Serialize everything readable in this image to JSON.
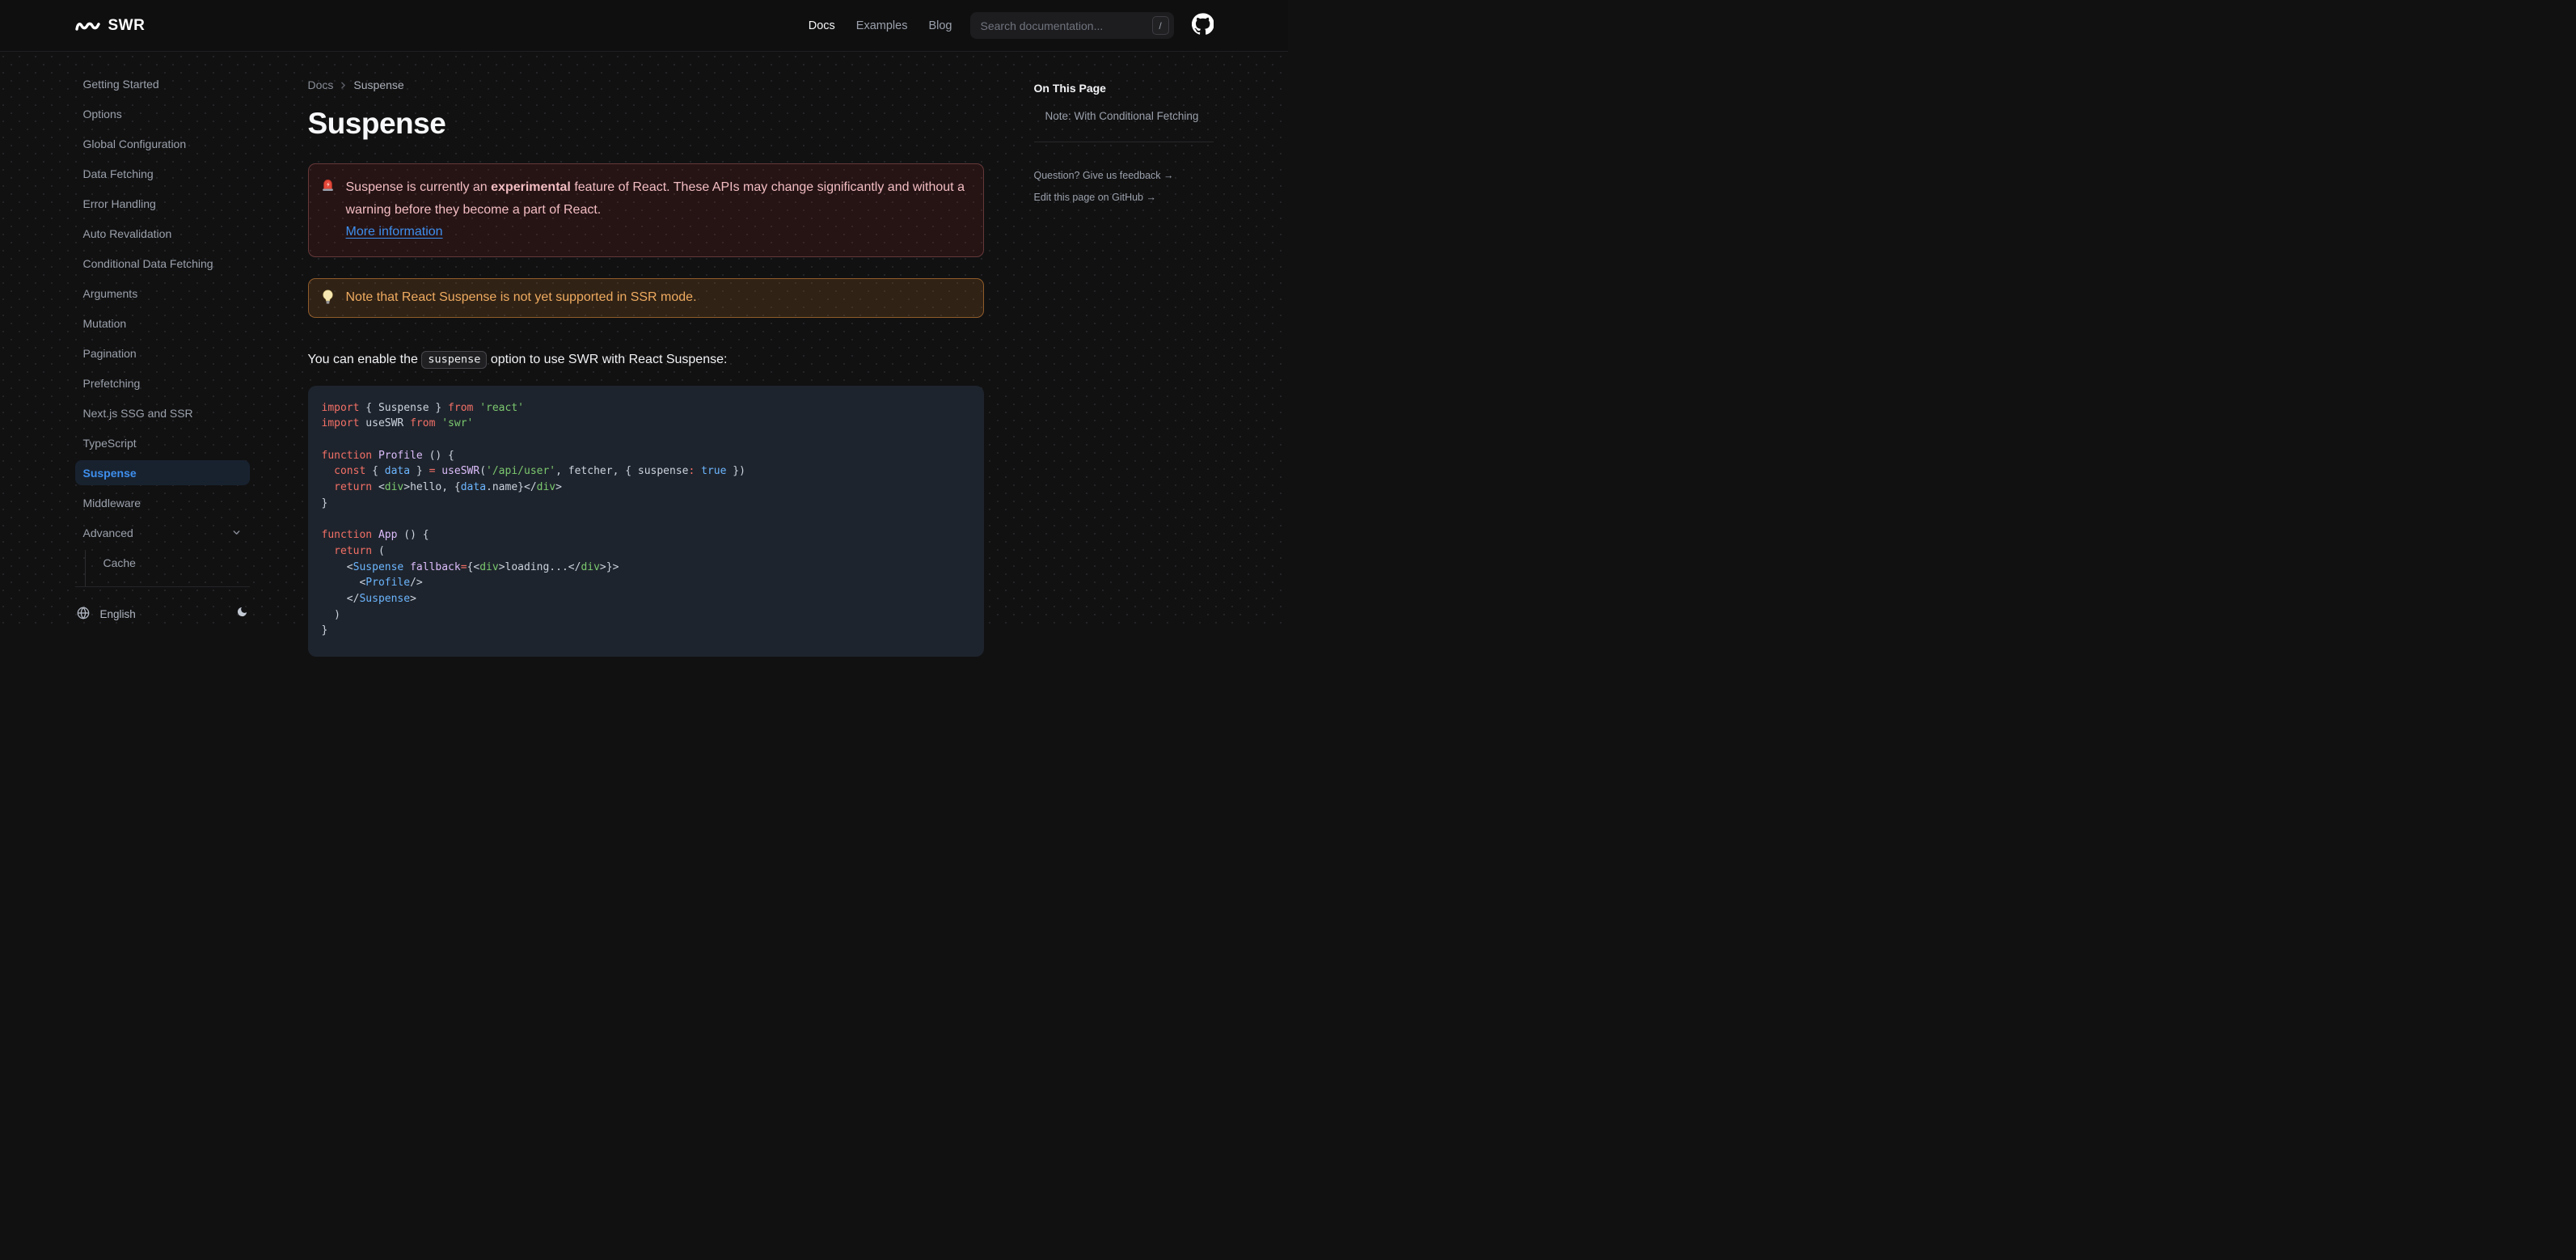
{
  "header": {
    "logo_text": "SWR",
    "nav": [
      {
        "label": "Docs",
        "active": true
      },
      {
        "label": "Examples",
        "active": false
      },
      {
        "label": "Blog",
        "active": false
      }
    ],
    "search": {
      "placeholder": "Search documentation...",
      "kbd": "/"
    },
    "github_icon": "github-icon"
  },
  "sidebar": {
    "items": [
      {
        "label": "Getting Started"
      },
      {
        "label": "Options"
      },
      {
        "label": "Global Configuration"
      },
      {
        "label": "Data Fetching"
      },
      {
        "label": "Error Handling"
      },
      {
        "label": "Auto Revalidation"
      },
      {
        "label": "Conditional Data Fetching"
      },
      {
        "label": "Arguments"
      },
      {
        "label": "Mutation"
      },
      {
        "label": "Pagination"
      },
      {
        "label": "Prefetching"
      },
      {
        "label": "Next.js SSG and SSR"
      },
      {
        "label": "TypeScript"
      },
      {
        "label": "Suspense",
        "active": true
      },
      {
        "label": "Middleware"
      },
      {
        "label": "Advanced",
        "chevron": true
      },
      {
        "label": "Cache",
        "sub": true
      }
    ],
    "footer": {
      "language": "English",
      "globe_icon": "globe-icon",
      "moon_icon": "moon-icon"
    }
  },
  "breadcrumb": {
    "parent": "Docs",
    "current": "Suspense"
  },
  "page": {
    "title": "Suspense",
    "callout_error": {
      "icon": "police-car-light-icon",
      "text_before": "Suspense is currently an ",
      "text_bold": "experimental",
      "text_after": " feature of React. These APIs may change significantly and without a warning before they become a part of React.",
      "link_label": "More information"
    },
    "callout_note": {
      "icon": "light-bulb-icon",
      "text": "Note that React Suspense is not yet supported in SSR mode."
    },
    "paragraph": {
      "before": "You can enable the ",
      "code": "suspense",
      "after": " option to use SWR with React Suspense:"
    }
  },
  "code_block": {
    "language": "jsx",
    "colors": {
      "keyword": "#f47067",
      "string_and_tag": "#7bc86f",
      "function": "#dcbdfb",
      "constant": "#6cb6ff",
      "plain": "#cdd3dc",
      "background": "#1e242d"
    },
    "lines": [
      [
        [
          "k",
          "import"
        ],
        [
          "p",
          " { Suspense } "
        ],
        [
          "k",
          "from"
        ],
        [
          "p",
          " "
        ],
        [
          "s",
          "'react'"
        ]
      ],
      [
        [
          "k",
          "import"
        ],
        [
          "p",
          " useSWR "
        ],
        [
          "k",
          "from"
        ],
        [
          "p",
          " "
        ],
        [
          "s",
          "'swr'"
        ]
      ],
      [],
      [
        [
          "k",
          "function"
        ],
        [
          "p",
          " "
        ],
        [
          "f",
          "Profile"
        ],
        [
          "p",
          " () {"
        ]
      ],
      [
        [
          "p",
          "  "
        ],
        [
          "k",
          "const"
        ],
        [
          "p",
          " { "
        ],
        [
          "c",
          "data"
        ],
        [
          "p",
          " } "
        ],
        [
          "k",
          "="
        ],
        [
          "p",
          " "
        ],
        [
          "f",
          "useSWR"
        ],
        [
          "p",
          "("
        ],
        [
          "s",
          "'/api/user'"
        ],
        [
          "p",
          ", fetcher, { suspense"
        ],
        [
          "k",
          ":"
        ],
        [
          "p",
          " "
        ],
        [
          "c",
          "true"
        ],
        [
          "p",
          " })"
        ]
      ],
      [
        [
          "p",
          "  "
        ],
        [
          "k",
          "return"
        ],
        [
          "p",
          " <"
        ],
        [
          "s",
          "div"
        ],
        [
          "p",
          ">hello, {"
        ],
        [
          "c",
          "data"
        ],
        [
          "p",
          ".name}</"
        ],
        [
          "s",
          "div"
        ],
        [
          "p",
          ">"
        ]
      ],
      [
        [
          "p",
          "}"
        ]
      ],
      [],
      [
        [
          "k",
          "function"
        ],
        [
          "p",
          " "
        ],
        [
          "f",
          "App"
        ],
        [
          "p",
          " () {"
        ]
      ],
      [
        [
          "p",
          "  "
        ],
        [
          "k",
          "return"
        ],
        [
          "p",
          " ("
        ]
      ],
      [
        [
          "p",
          "    <"
        ],
        [
          "c",
          "Suspense"
        ],
        [
          "p",
          " "
        ],
        [
          "f",
          "fallback"
        ],
        [
          "k",
          "="
        ],
        [
          "p",
          "{<"
        ],
        [
          "s",
          "div"
        ],
        [
          "p",
          ">loading...</"
        ],
        [
          "s",
          "div"
        ],
        [
          "p",
          ">}>"
        ]
      ],
      [
        [
          "p",
          "      <"
        ],
        [
          "c",
          "Profile"
        ],
        [
          "p",
          "/>"
        ]
      ],
      [
        [
          "p",
          "    </"
        ],
        [
          "c",
          "Suspense"
        ],
        [
          "p",
          ">"
        ]
      ],
      [
        [
          "p",
          "  )"
        ]
      ],
      [
        [
          "p",
          "}"
        ]
      ]
    ]
  },
  "toc": {
    "title": "On This Page",
    "items": [
      "Note: With Conditional Fetching"
    ],
    "links": [
      "Question? Give us feedback →",
      "Edit this page on GitHub →"
    ]
  },
  "colors": {
    "accent_blue": "#3e8fee",
    "active_item_bg": "#18222f",
    "error_text": "#f3bdc2",
    "note_text": "#efab60",
    "page_bg": "#111112"
  }
}
